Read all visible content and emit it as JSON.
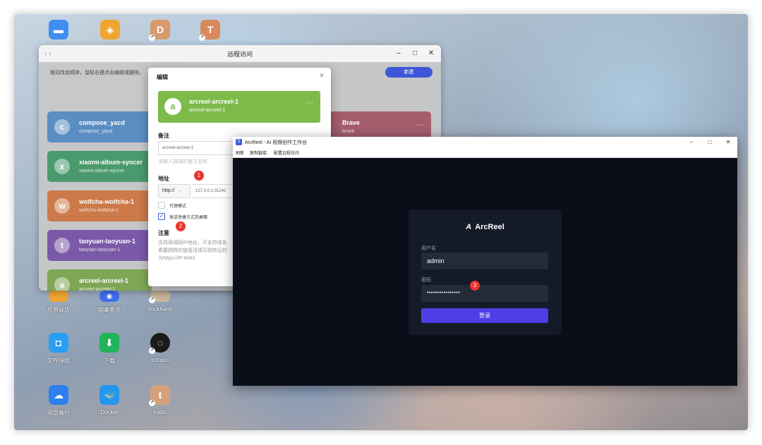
{
  "desktop": {
    "icons": [
      {
        "label": "",
        "glyph": "▬",
        "color": "#3f8ef0"
      },
      {
        "label": "",
        "glyph": "◈",
        "color": "#f0a530"
      },
      {
        "label": "",
        "glyph": "D",
        "color": "#d99a6c"
      },
      {
        "label": "",
        "glyph": "T",
        "color": "#d98a5c"
      },
      {
        "label": "应用商店",
        "glyph": "",
        "color": "#f0a530"
      },
      {
        "label": "病毒查杀",
        "glyph": "◉",
        "color": "#3f6ef0"
      },
      {
        "label": "dockhand",
        "glyph": "",
        "color": "#c9b79a"
      },
      {
        "label": "文件快照",
        "glyph": "◘",
        "color": "#2a9df4"
      },
      {
        "label": "下载",
        "glyph": "⬇",
        "color": "#20b45b"
      },
      {
        "label": "octopus",
        "glyph": "◌",
        "color": "#1a1a1a"
      },
      {
        "label": "网盘备份",
        "glyph": "☁",
        "color": "#2d7ff0"
      },
      {
        "label": "Docker",
        "glyph": "🐳",
        "color": "#2496ed"
      },
      {
        "label": "tradis",
        "glyph": "t",
        "color": "#d4a27a"
      }
    ]
  },
  "remote_window": {
    "title": "远程访问",
    "nav": "‹  ›",
    "controls": {
      "minimize": "–",
      "maximize": "□",
      "close": "✕"
    },
    "hint": "拖动改变顺序，鼠标右键点击编辑或删除。",
    "new_button": "新建",
    "cards": [
      {
        "letter": "c",
        "name": "compose_yacd",
        "sub": "compose_yacd",
        "color": "#5a8ec2"
      },
      {
        "letter": "x",
        "name": "xiaomi-album-syncer",
        "sub": "xiaomi-album-syncer",
        "color": "#4a9a6e"
      },
      {
        "letter": "w",
        "name": "wolfcha-wolfcha-1",
        "sub": "wolfcha-wolfcha-1",
        "color": "#cc7a4a"
      },
      {
        "letter": "t",
        "name": "taoyuan-taoyuan-1",
        "sub": "taoyuan-taoyuan-1",
        "color": "#7a5aa8"
      },
      {
        "letter": "a",
        "name": "arcreel-arcreel-1",
        "sub": "arcreel-arcreel-1",
        "color": "#7fa655"
      },
      {
        "letter": "",
        "name": "Brave",
        "sub": "brave",
        "color": "#a45d6c",
        "dots": "···"
      }
    ]
  },
  "edit_dialog": {
    "title": "编辑",
    "close": "×",
    "card": {
      "letter": "a",
      "name": "arcreel-arcreel-1",
      "sub": "arcreel-arcreel-1",
      "dots": "···"
    },
    "remark_label": "备注",
    "remark_value": "arcreel-arcreel-1",
    "remark_hint": "请输入链接的备注名称",
    "address_label": "地址",
    "protocol": "http://",
    "protocol_arrow": "⌄",
    "address_value": "127.0.0.1:31241",
    "proxy_label": "代理模式",
    "shortcut_label": "发送快捷方式到桌面",
    "shortcut_check": "✓",
    "note_title": "注意",
    "note_lines": [
      "支持局域网IP地址，不支持域名",
      "需要跳转的链接请填写跳转后的",
      "为https://IP:8443"
    ]
  },
  "markers": [
    "1",
    "2",
    "3"
  ],
  "arcreel": {
    "title": "ArcReel - AI 视频创作工作台",
    "app_icon": "S",
    "controls": {
      "minimize": "–",
      "maximize": "□",
      "close": "✕"
    },
    "menu": [
      "刷新",
      "复制链接",
      "配置远程访问"
    ],
    "brand": "ArcReel",
    "logo": "A",
    "username_label": "用户名",
    "username": "admin",
    "password_label": "密码",
    "password_mask": "••••••••••••••••",
    "login_button": "登录"
  }
}
